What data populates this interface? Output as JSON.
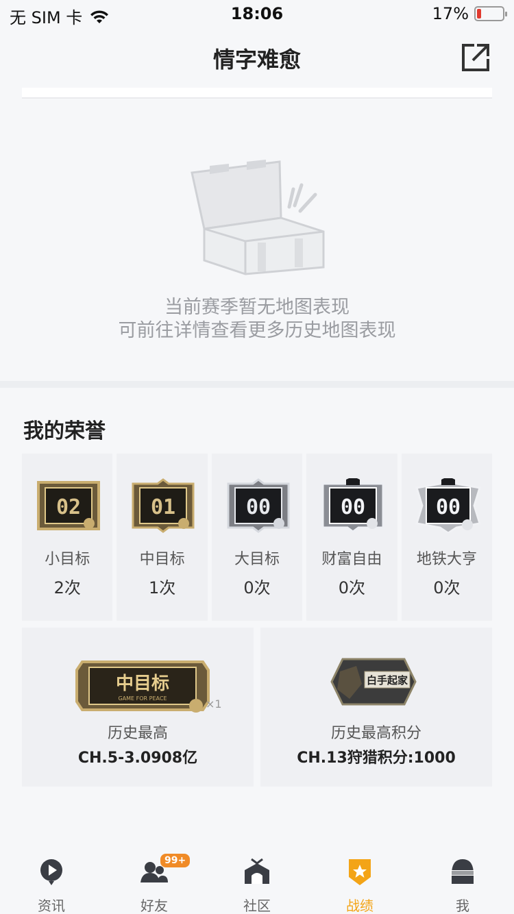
{
  "status_bar": {
    "carrier": "无 SIM 卡",
    "time": "18:06",
    "battery_text": "17%",
    "battery_level": 0.17
  },
  "nav": {
    "title": "情字难愈"
  },
  "map_section": {
    "empty_title": "当前赛季暂无地图表现",
    "empty_subtitle": "可前往详情查看更多历史地图表现"
  },
  "honors": {
    "title": "我的荣誉",
    "items": [
      {
        "badge_text": "02",
        "label": "小目标",
        "count": "2次"
      },
      {
        "badge_text": "01",
        "label": "中目标",
        "count": "1次"
      },
      {
        "badge_text": "00",
        "label": "大目标",
        "count": "0次"
      },
      {
        "badge_text": "00",
        "label": "财富自由",
        "count": "0次"
      },
      {
        "badge_text": "00",
        "label": "地铁大亨",
        "count": "0次"
      }
    ],
    "records": [
      {
        "badge_text": "中目标",
        "badge_sub": "GAME FOR PEACE",
        "multiplier": "×1",
        "label": "历史最高",
        "value": "CH.5-3.0908亿"
      },
      {
        "badge_text": "白手起家",
        "label": "历史最高积分",
        "value": "CH.13狩猎积分:1000"
      }
    ]
  },
  "tab_bar": {
    "items": [
      {
        "label": "资讯",
        "icon": "news-icon"
      },
      {
        "label": "好友",
        "icon": "friends-icon",
        "badge": "99+"
      },
      {
        "label": "社区",
        "icon": "community-icon"
      },
      {
        "label": "战绩",
        "icon": "record-icon",
        "active": true
      },
      {
        "label": "我",
        "icon": "me-icon"
      }
    ]
  },
  "colors": {
    "accent": "#f3a417",
    "badge": "#f08b27",
    "battery_low": "#e0392e"
  }
}
